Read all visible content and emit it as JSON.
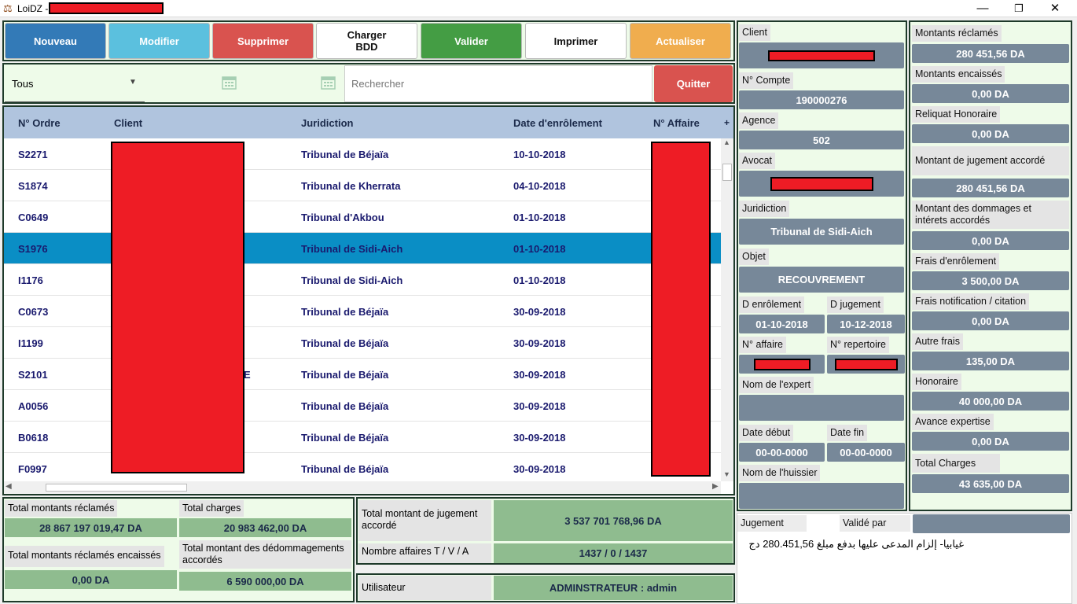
{
  "window": {
    "title": "LoiDZ -",
    "minimize": "—",
    "maximize": "❐",
    "close": "✕"
  },
  "toolbar": {
    "nouveau": "Nouveau",
    "modifier": "Modifier",
    "supprimer": "Supprimer",
    "charger": "Charger BDD",
    "valider": "Valider",
    "imprimer": "Imprimer",
    "actualiser": "Actualiser"
  },
  "filter": {
    "select_value": "Tous",
    "search_placeholder": "Rechercher",
    "quitter": "Quitter"
  },
  "table": {
    "headers": {
      "ordre": "N° Ordre",
      "client": "Client",
      "juridiction": "Juridiction",
      "date": "Date d'enrôlement",
      "affaire": "N° Affaire",
      "add": "+"
    },
    "rows": [
      {
        "ordre": "S2271",
        "juridiction": "Tribunal de Béjaïa",
        "date": "10-10-2018"
      },
      {
        "ordre": "S1874",
        "juridiction": "Tribunal de Kherrata",
        "date": "04-10-2018"
      },
      {
        "ordre": "C0649",
        "juridiction": "Tribunal d'Akbou",
        "date": "01-10-2018"
      },
      {
        "ordre": "S1976",
        "juridiction": "Tribunal de Sidi-Aich",
        "date": "01-10-2018"
      },
      {
        "ordre": "I1176",
        "juridiction": "Tribunal de Sidi-Aich",
        "date": "01-10-2018"
      },
      {
        "ordre": "C0673",
        "juridiction": "Tribunal de Béjaïa",
        "date": "30-09-2018"
      },
      {
        "ordre": "I1199",
        "juridiction": "Tribunal de Béjaïa",
        "date": "30-09-2018"
      },
      {
        "ordre": "S2101",
        "juridiction": "Tribunal de Béjaïa",
        "date": "30-09-2018",
        "client_tail": "E"
      },
      {
        "ordre": "A0056",
        "juridiction": "Tribunal de Béjaïa",
        "date": "30-09-2018"
      },
      {
        "ordre": "B0618",
        "juridiction": "Tribunal de Béjaïa",
        "date": "30-09-2018"
      },
      {
        "ordre": "F0997",
        "juridiction": "Tribunal de Béjaïa",
        "date": "30-09-2018"
      }
    ]
  },
  "totals": {
    "reclames_label": "Total montants réclamés",
    "reclames_value": "28 867 197 019,47  DA",
    "charges_label": "Total charges",
    "charges_value": "20 983 462,00  DA",
    "encaisses_label": "Total montants réclamés encaissés",
    "encaisses_value": "0,00  DA",
    "dedommagements_label": "Total montant des dédommagements accordés",
    "dedommagements_value": "6 590 000,00  DA",
    "jugement_label": "Total montant de jugement accordé",
    "jugement_value": "3 537 701 768,96  DA",
    "nombre_label": "Nombre affaires T / V / A",
    "nombre_value": "1437 / 0 / 1437",
    "user_label": "Utilisateur",
    "user_value": "ADMINSTRATEUR : admin"
  },
  "details": {
    "client_label": "Client",
    "compte_label": "N° Compte",
    "compte_value": "190000276",
    "agence_label": "Agence",
    "agence_value": "502",
    "avocat_label": "Avocat",
    "juridiction_label": "Juridiction",
    "juridiction_value": "Tribunal de Sidi-Aich",
    "objet_label": "Objet",
    "objet_value": "RECOUVREMENT",
    "denrolement_label": "D enrôlement",
    "denrolement_value": "01-10-2018",
    "djugement_label": "D jugement",
    "djugement_value": "10-12-2018",
    "naffaire_label": "N° affaire",
    "nrepertoire_label": "N° repertoire",
    "expert_label": "Nom de l'expert",
    "datedebut_label": "Date début",
    "datedebut_value": "00-00-0000",
    "datefin_label": "Date fin",
    "datefin_value": "00-00-0000",
    "huissier_label": "Nom de l'huissier",
    "jugement_label": "Jugement",
    "valide_label": "Validé par",
    "jugement_text": "غيابيا- إلزام المدعى عليها بدفع مبلغ 280.451,56 دج"
  },
  "amounts": {
    "reclames_label": "Montants réclamés",
    "reclames_value": "280 451,56  DA",
    "encaisses_label": "Montants encaissés",
    "encaisses_value": "0,00  DA",
    "reliquat_label": "Reliquat Honoraire",
    "reliquat_value": "0,00  DA",
    "jugement_label": "Montant de jugement accordé",
    "jugement_value": "280 451,56  DA",
    "dommages_label": "Montant des dommages et intérets accordés",
    "dommages_value": "0,00  DA",
    "enrolement_label": "Frais d'enrôlement",
    "enrolement_value": "3 500,00  DA",
    "notification_label": "Frais notification / citation",
    "notification_value": "0,00  DA",
    "autres_label": "Autre frais",
    "autres_value": "135,00  DA",
    "honoraire_label": "Honoraire",
    "honoraire_value": "40 000,00  DA",
    "avance_label": "Avance expertise",
    "avance_value": "0,00  DA",
    "total_label": "Total Charges",
    "total_value": "43 635,00  DA"
  }
}
